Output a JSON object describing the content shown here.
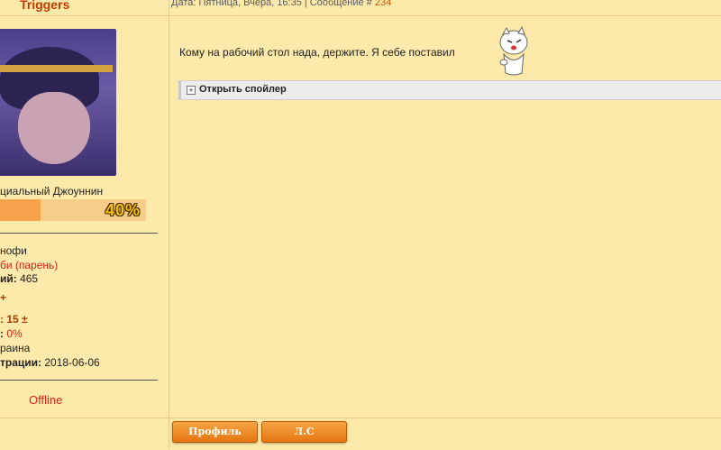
{
  "user": {
    "name": "Triggers",
    "rank": "циальный Джоуннин",
    "progress_percent": 40,
    "progress_label": "40%",
    "status": "Offline"
  },
  "stats": [
    {
      "label": "нофи",
      "value": ""
    },
    {
      "label": "би (парень)",
      "value": ""
    },
    {
      "label": "ий:",
      "value": " 465"
    },
    {
      "label": "+",
      "value": ""
    },
    {
      "label": ":",
      "value": " 15  ±"
    },
    {
      "label": ":",
      "value": " 0%"
    },
    {
      "label": "раина",
      "value": ""
    },
    {
      "label": "трации:",
      "value": " 2018-06-06"
    }
  ],
  "post": {
    "meta_prefix": "Дата: Пятница, Вчера, 16:35 | Сообщение # ",
    "number": "234",
    "text": "Кому на рабочий стол нада, держите. Я себе поставил",
    "spoiler_toggle": "+",
    "spoiler_label": "Открыть спойлер"
  },
  "buttons": {
    "profile": "Профиль",
    "pm": "Л.С"
  },
  "colors": {
    "background": "#fde9a9",
    "username": "#c33b00",
    "offline": "#d9241a",
    "button": "#f39233"
  }
}
